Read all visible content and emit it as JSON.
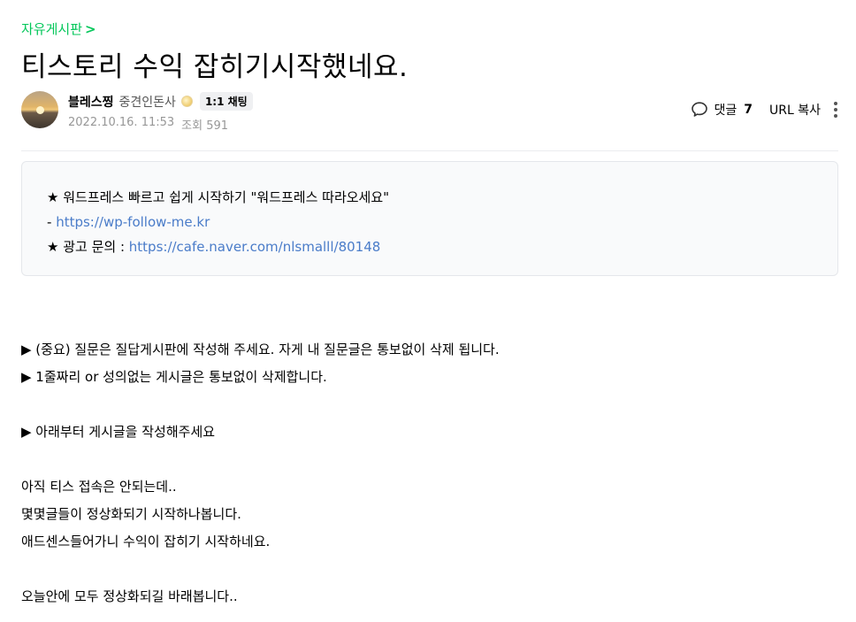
{
  "board": {
    "name": "자유게시판",
    "chevron": ">"
  },
  "post": {
    "title": "티스토리 수익 잡히기시작했네요.",
    "author": {
      "nickname": "블레스찡",
      "level": "중견인돈사",
      "chat_label": "1:1 채팅"
    },
    "date": "2022.10.16. 11:53",
    "views_label": "조회 591",
    "comments_label": "댓글",
    "comments_count": "7",
    "url_copy_label": "URL 복사"
  },
  "notice": {
    "line1": "★ 워드프레스 빠르고 쉽게 시작하기 \"워드프레스 따라오세요\"",
    "line2_prefix": "- ",
    "line2_link": "https://wp-follow-me.kr",
    "line3_prefix": "★ 광고 문의 : ",
    "line3_link": "https://cafe.naver.com/nlsmalll/80148"
  },
  "body": {
    "rule1": "▶ (중요) 질문은 질답게시판에 작성해 주세요. 자게 내 질문글은 통보없이 삭제 됩니다.",
    "rule2": "▶ 1줄짜리 or 성의없는 게시글은 통보없이 삭제합니다.",
    "rule3": "▶ 아래부터 게시글을 작성해주세요",
    "p1": "아직 티스 접속은 안되는데..",
    "p2": "몇몇글들이 정상화되기 시작하나봅니다.",
    "p3": "애드센스들어가니 수익이 잡히기 시작하네요.",
    "p4": "오늘안에 모두 정상화되길 바래봅니다.."
  },
  "colors": {
    "board_link": "#03c75a",
    "link": "#4a7cc9",
    "meta": "#979797",
    "notice_bg": "#f9fafb"
  },
  "icons": [
    "chevron-right-icon",
    "level-badge-icon",
    "comment-icon",
    "more-vertical-icon"
  ]
}
